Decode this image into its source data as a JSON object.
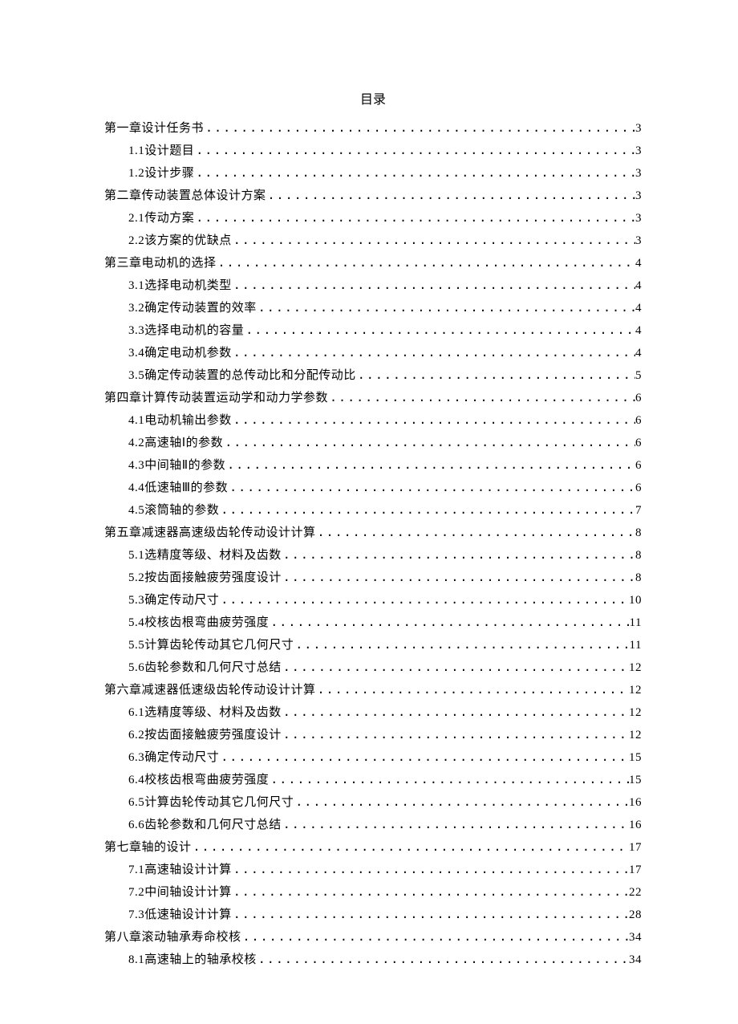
{
  "title": "目录",
  "toc": [
    {
      "level": 1,
      "label": "第一章设计任务书",
      "page": "3"
    },
    {
      "level": 2,
      "label": "1.1设计题目",
      "page": "3"
    },
    {
      "level": 2,
      "label": "1.2设计步骤",
      "page": "3"
    },
    {
      "level": 1,
      "label": "第二章传动装置总体设计方案",
      "page": "3"
    },
    {
      "level": 2,
      "label": "2.1传动方案",
      "page": "3"
    },
    {
      "level": 2,
      "label": "2.2该方案的优缺点",
      "page": "3"
    },
    {
      "level": 1,
      "label": "第三章电动机的选择",
      "page": "4"
    },
    {
      "level": 2,
      "label": "3.1选择电动机类型",
      "page": "4"
    },
    {
      "level": 2,
      "label": "3.2确定传动装置的效率",
      "page": "4"
    },
    {
      "level": 2,
      "label": "3.3选择电动机的容量",
      "page": "4"
    },
    {
      "level": 2,
      "label": "3.4确定电动机参数",
      "page": "4"
    },
    {
      "level": 2,
      "label": "3.5确定传动装置的总传动比和分配传动比",
      "page": "5"
    },
    {
      "level": 1,
      "label": "第四章计算传动装置运动学和动力学参数",
      "page": "6"
    },
    {
      "level": 2,
      "label": "4.1电动机输出参数",
      "page": "6"
    },
    {
      "level": 2,
      "label": "4.2高速轴Ⅰ的参数",
      "page": "6"
    },
    {
      "level": 2,
      "label": "4.3中间轴Ⅱ的参数",
      "page": "6"
    },
    {
      "level": 2,
      "label": "4.4低速轴Ⅲ的参数",
      "page": "6"
    },
    {
      "level": 2,
      "label": "4.5滚筒轴的参数",
      "page": "7"
    },
    {
      "level": 1,
      "label": "第五章减速器高速级齿轮传动设计计算",
      "page": "8"
    },
    {
      "level": 2,
      "label": "5.1选精度等级、材料及齿数",
      "page": "8"
    },
    {
      "level": 2,
      "label": "5.2按齿面接触疲劳强度设计",
      "page": "8"
    },
    {
      "level": 2,
      "label": "5.3确定传动尺寸",
      "page": "10"
    },
    {
      "level": 2,
      "label": "5.4校核齿根弯曲疲劳强度",
      "page": "11"
    },
    {
      "level": 2,
      "label": "5.5计算齿轮传动其它几何尺寸",
      "page": "11"
    },
    {
      "level": 2,
      "label": "5.6齿轮参数和几何尺寸总结",
      "page": "12"
    },
    {
      "level": 1,
      "label": "第六章减速器低速级齿轮传动设计计算",
      "page": "12"
    },
    {
      "level": 2,
      "label": "6.1选精度等级、材料及齿数",
      "page": "12"
    },
    {
      "level": 2,
      "label": "6.2按齿面接触疲劳强度设计",
      "page": "12"
    },
    {
      "level": 2,
      "label": "6.3确定传动尺寸",
      "page": "15"
    },
    {
      "level": 2,
      "label": "6.4校核齿根弯曲疲劳强度",
      "page": "15"
    },
    {
      "level": 2,
      "label": "6.5计算齿轮传动其它几何尺寸",
      "page": "16"
    },
    {
      "level": 2,
      "label": "6.6齿轮参数和几何尺寸总结",
      "page": "16"
    },
    {
      "level": 1,
      "label": "第七章轴的设计",
      "page": "17"
    },
    {
      "level": 2,
      "label": "7.1高速轴设计计算",
      "page": "17"
    },
    {
      "level": 2,
      "label": "7.2中间轴设计计算",
      "page": "22"
    },
    {
      "level": 2,
      "label": "7.3低速轴设计计算",
      "page": "28"
    },
    {
      "level": 1,
      "label": "第八章滚动轴承寿命校核",
      "page": "34"
    },
    {
      "level": 2,
      "label": "8.1高速轴上的轴承校核",
      "page": "34"
    }
  ]
}
